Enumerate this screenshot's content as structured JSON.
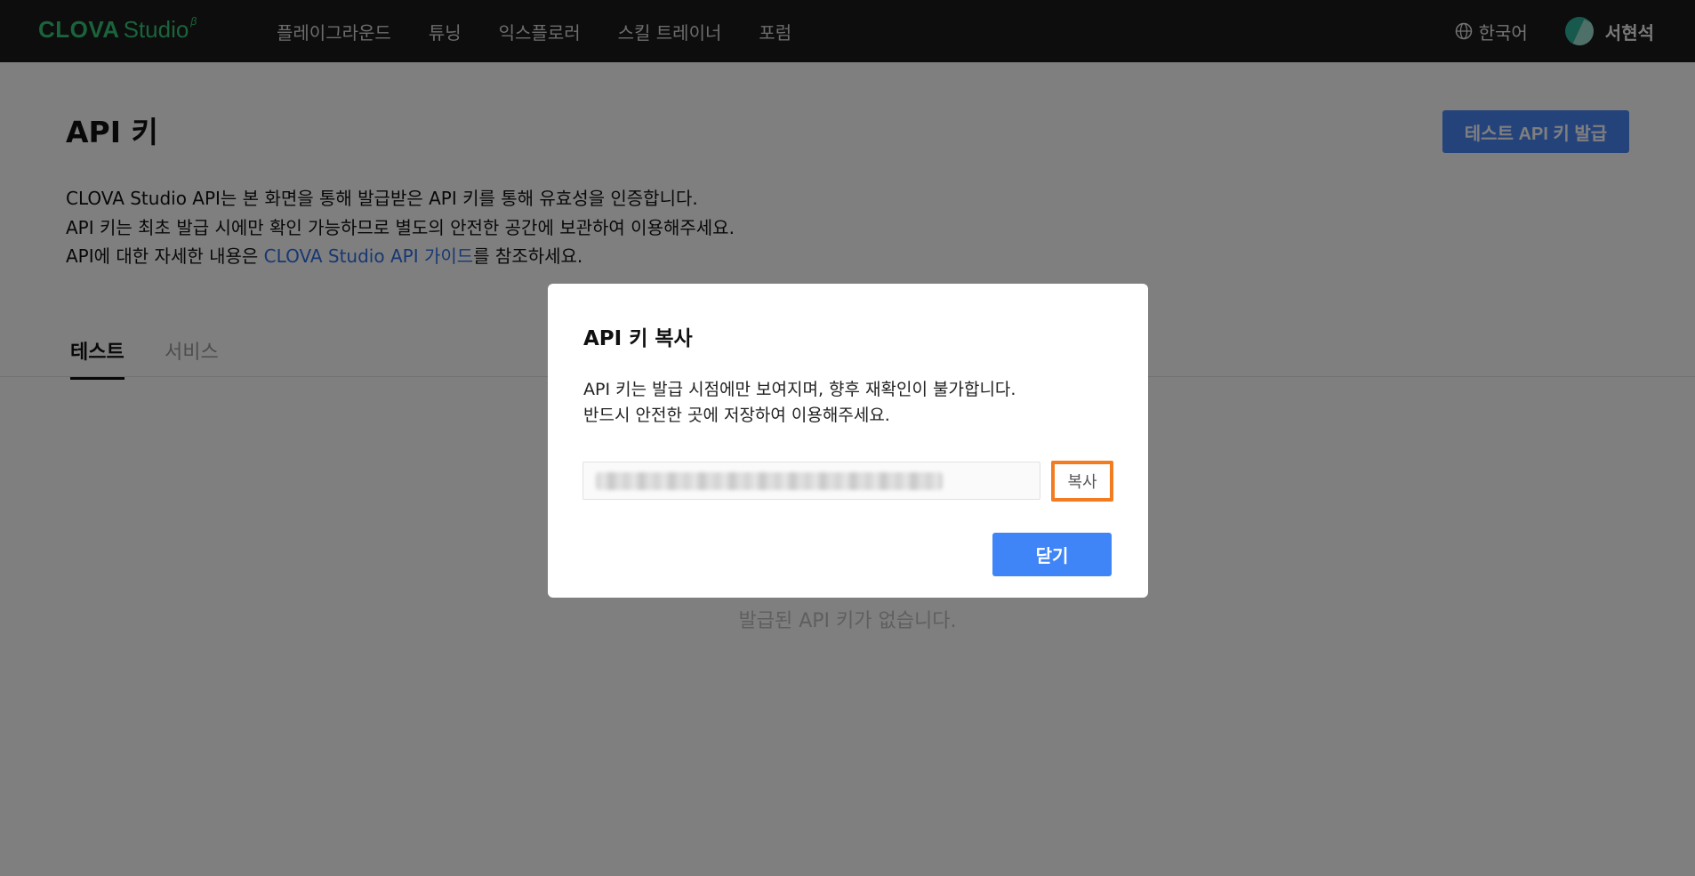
{
  "app": {
    "logo_clova": "CLOVA",
    "logo_studio": "Studio",
    "logo_beta": "β"
  },
  "nav": {
    "items": [
      "플레이그라운드",
      "튜닝",
      "익스플로러",
      "스킬 트레이너",
      "포럼"
    ],
    "language": "한국어",
    "user_name": "서현석"
  },
  "page": {
    "title": "API 키",
    "issue_button": "테스트 API 키 발급",
    "desc_line1": "CLOVA Studio API는 본 화면을 통해 발급받은 API 키를 통해 유효성을 인증합니다.",
    "desc_line2": "API 키는 최초 발급 시에만 확인 가능하므로 별도의 안전한 공간에 보관하여 이용해주세요.",
    "desc_line3_prefix": "API에 대한 자세한 내용은 ",
    "desc_line3_link": "CLOVA Studio API 가이드",
    "desc_line3_suffix": "를 참조하세요.",
    "tabs": [
      "테스트",
      "서비스"
    ],
    "active_tab": "테스트",
    "empty_message": "발급된 API 키가 없습니다."
  },
  "modal": {
    "title": "API 키 복사",
    "text_line1": "API 키는 발급 시점에만 보여지며, 향후 재확인이 불가합니다.",
    "text_line2": "반드시 안전한 곳에 저장하여 이용해주세요.",
    "copy_button": "복사",
    "close_button": "닫기"
  },
  "colors": {
    "brand_green": "#34c777",
    "primary_blue": "#3f85f7",
    "highlight_orange": "#f47c20",
    "topbar": "#1b1b1b"
  }
}
